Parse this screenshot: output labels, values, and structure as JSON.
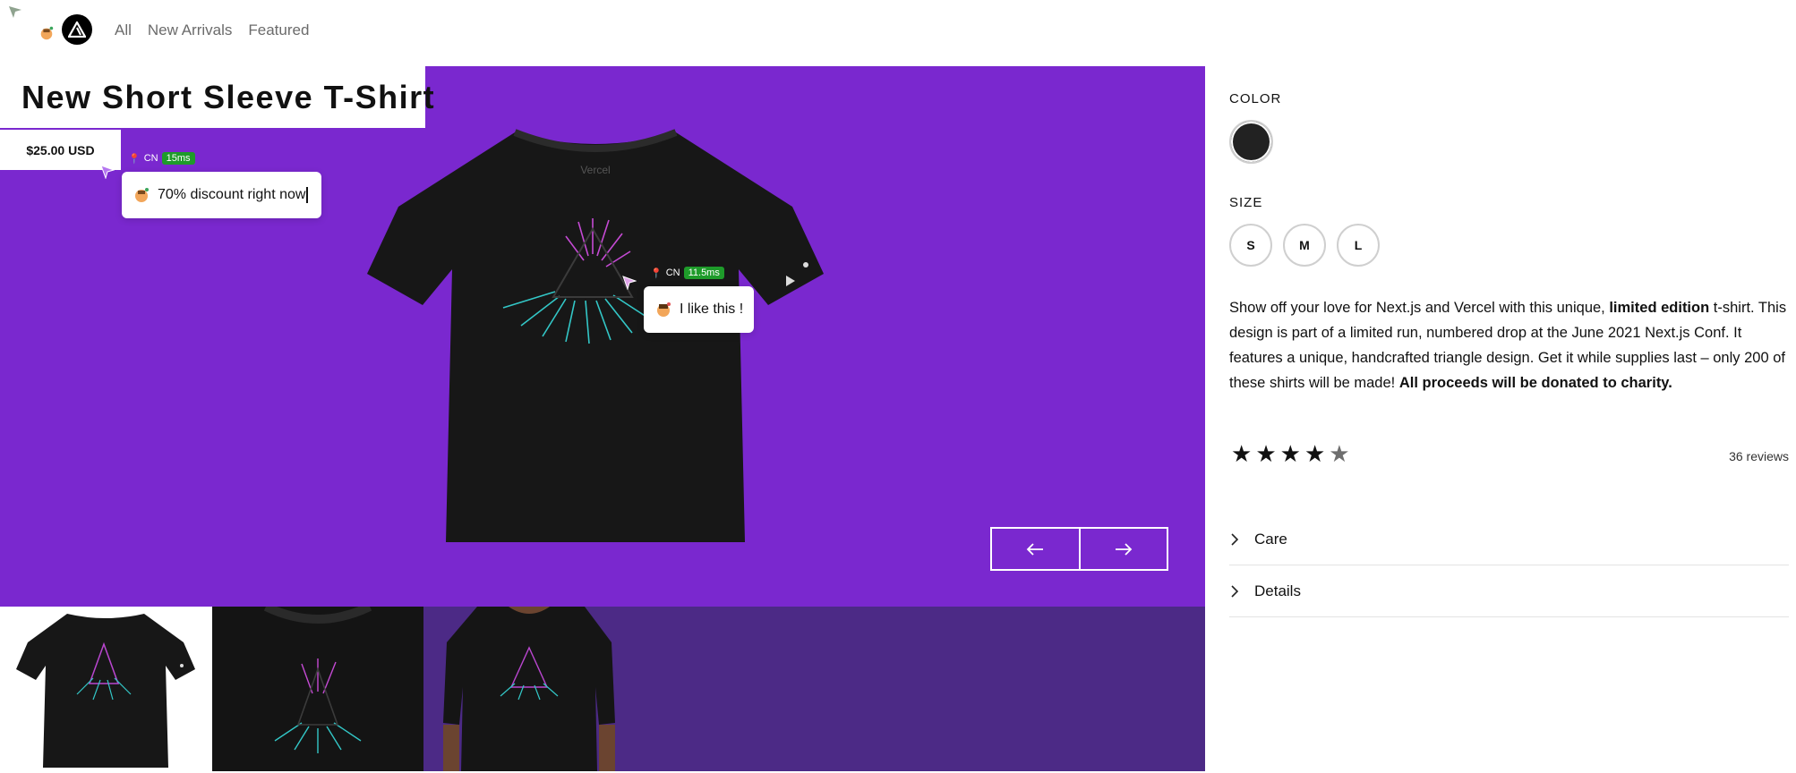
{
  "header": {
    "nav": [
      "All",
      "New Arrivals",
      "Featured"
    ]
  },
  "product": {
    "title": "New Short Sleeve T-Shirt",
    "price": "$25.00 USD",
    "print_text": "Vercel"
  },
  "presence": [
    {
      "country": "CN",
      "latency": "15ms",
      "message": "70% discount right now"
    },
    {
      "country": "CN",
      "latency": "11.5ms",
      "message": "I like this !"
    }
  ],
  "options": {
    "color_label": "COLOR",
    "colors": [
      {
        "name": "Black",
        "hex": "#222222"
      }
    ],
    "size_label": "SIZE",
    "sizes": [
      "S",
      "M",
      "L"
    ]
  },
  "description": {
    "part1": "Show off your love for Next.js and Vercel with this unique, ",
    "bold1": "limited edition",
    "part2": " t-shirt. This design is part of a limited run, numbered drop at the June 2021 Next.js Conf. It features a unique, handcrafted triangle design. Get it while supplies last – only 200 of these shirts will be made! ",
    "bold2": "All proceeds will be donated to charity."
  },
  "rating": {
    "value": 4,
    "max": 5,
    "reviews": "36 reviews"
  },
  "accordion": [
    "Care",
    "Details"
  ],
  "colors": {
    "gallery_bg": "#7a28cf",
    "thumb_strip_bg": "#4c2a86",
    "latency_badge": "#1e9b2a"
  }
}
